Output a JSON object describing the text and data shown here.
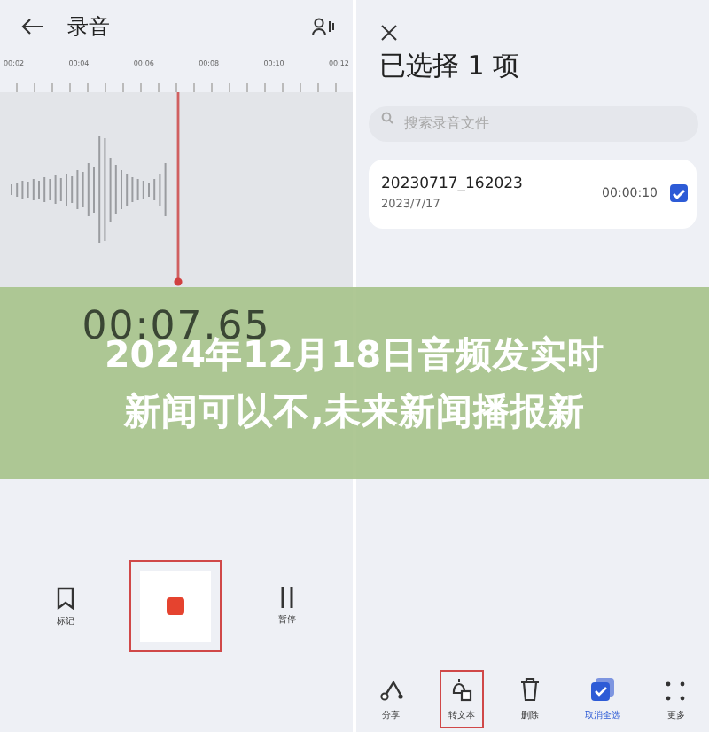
{
  "recorder": {
    "title": "录音",
    "ruler_labels": [
      "00:02",
      "00:04",
      "00:06",
      "00:08",
      "00:10",
      "00:12"
    ],
    "timer": "00:07.65",
    "actions": [
      {
        "kind": "bookmark",
        "label": "标记",
        "highlighted": false
      },
      {
        "kind": "stop",
        "highlighted": true
      },
      {
        "kind": "pause",
        "label": "暂停",
        "highlighted": false
      }
    ]
  },
  "selection": {
    "title": "已选择 1 项",
    "search": {
      "placeholder": "搜索录音文件"
    },
    "files": [
      {
        "name": "20230717_162023",
        "date": "2023/7/17",
        "duration": "00:00:10",
        "checked": true
      }
    ],
    "toolbar": [
      {
        "kind": "share",
        "label": "分享",
        "highlighted": false,
        "active": false
      },
      {
        "kind": "to-text",
        "label": "转文本",
        "highlighted": true,
        "active": false
      },
      {
        "kind": "delete",
        "label": "删除",
        "highlighted": false,
        "active": false
      },
      {
        "kind": "deselect",
        "label": "取消全选",
        "highlighted": false,
        "active": true
      },
      {
        "kind": "more",
        "label": "更多",
        "highlighted": false,
        "active": false
      }
    ]
  },
  "banner": {
    "lines": [
      "2024年12月18日音频发实时",
      "新闻可以不,未来新闻播报新"
    ]
  }
}
